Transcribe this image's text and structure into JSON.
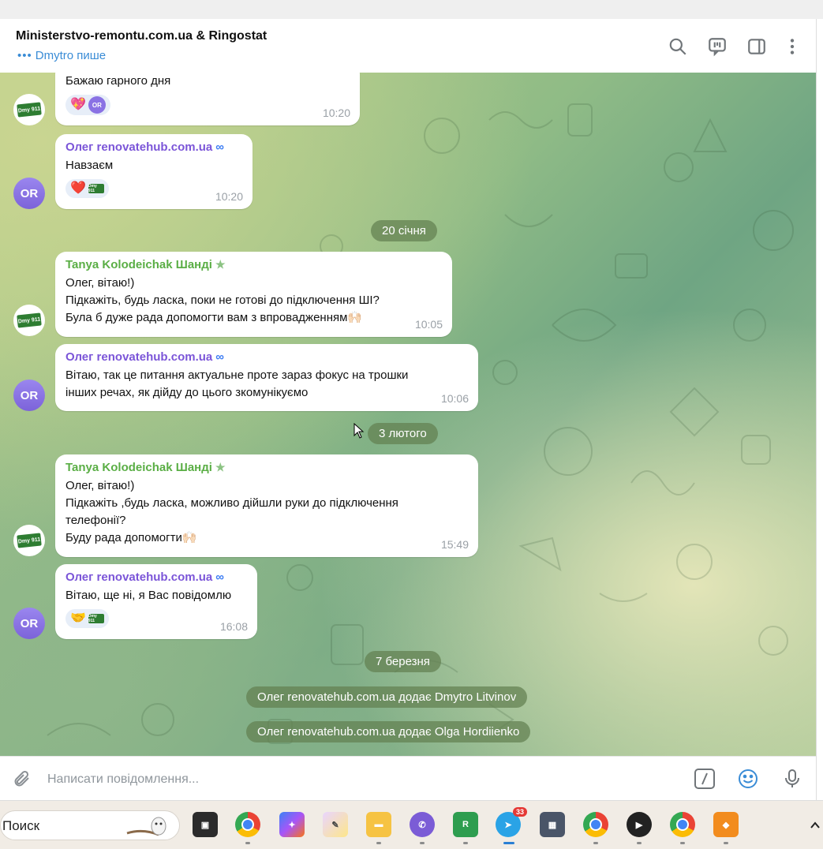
{
  "window": {
    "title": "Ministerstvo-remontu.com.ua & Ringostat",
    "typing_status": "Dmytro пише"
  },
  "header_icons": [
    "search-icon",
    "video-chat-icon",
    "sidebar-toggle-icon",
    "more-vertical-icon"
  ],
  "messages": [
    {
      "sender": "",
      "lines": [
        "Бажаю гарного дня"
      ],
      "time": "10:20",
      "reactions": [
        "💖"
      ],
      "reaction_avatar": "OR",
      "avatar": "Dmy 911"
    },
    {
      "sender": "Олег renovatehub.com.ua",
      "lines": [
        "Навзаєм"
      ],
      "time": "10:20",
      "reactions": [
        "❤️"
      ],
      "reaction_logo": "Dmy 911",
      "avatar": "OR"
    },
    {
      "sender": "Tanya Kolodeichak Шанді",
      "lines": [
        "Олег, вітаю!)",
        "Підкажіть, будь ласка, поки не готові до підключення ШІ?",
        "Була б дуже рада допомогти вам з впровадженням🙌🏻"
      ],
      "time": "10:05",
      "avatar": "Dmy 911"
    },
    {
      "sender": "Олег renovatehub.com.ua",
      "lines": [
        "Вітаю, так це питання актуальне проте зараз фокус на трошки",
        "інших речах, як дійду до цього зкомунікуємо"
      ],
      "time": "10:06",
      "avatar": "OR"
    },
    {
      "sender": "Tanya Kolodeichak Шанді",
      "lines": [
        "Олег, вітаю!)",
        "Підкажіть ,будь ласка, можливо дійшли руки до підключення",
        "телефонії?",
        "Буду рада допомогти🙌🏻"
      ],
      "time": "15:49",
      "avatar": "Dmy 911"
    },
    {
      "sender": "Олег renovatehub.com.ua",
      "lines": [
        "Вітаю, ще ні, я Вас повідомлю"
      ],
      "time": "16:08",
      "reactions": [
        "🤝"
      ],
      "reaction_logo": "Dmy 911",
      "avatar": "OR"
    }
  ],
  "date_separators": [
    "20 січня",
    "3 лютого",
    "7 березня"
  ],
  "service_messages": [
    "Олег renovatehub.com.ua додає Dmytro Litvinov",
    "Олег renovatehub.com.ua додає Olga Hordiienko"
  ],
  "composer": {
    "placeholder": "Написати повідомлення...",
    "icons": [
      "attach-icon",
      "commands-icon",
      "emoji-icon",
      "microphone-icon"
    ]
  },
  "taskbar": {
    "search_label": "Поиск",
    "telegram_badge": "33",
    "apps": [
      "task-view",
      "chrome",
      "copilot",
      "paint",
      "file-explorer",
      "viber",
      "ringostat",
      "telegram",
      "calculator",
      "chrome-profile",
      "media-player",
      "chrome-profile-2",
      "app-orange"
    ]
  },
  "colors": {
    "sender_oleg": "#7b55d8",
    "sender_tanya": "#5aae45",
    "accent_link": "#3a8cd6",
    "avatar_or": "#8a72e4"
  }
}
